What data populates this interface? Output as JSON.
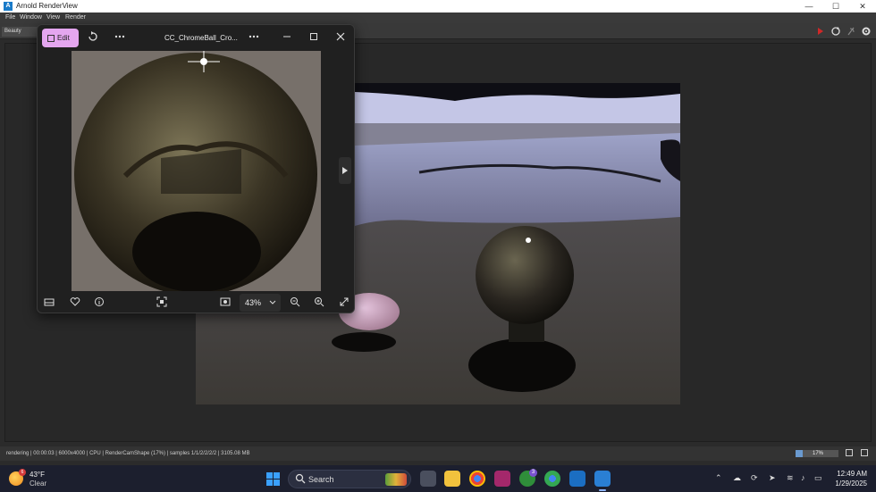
{
  "window": {
    "app_icon_glyph": "A",
    "title": "Arnold RenderView",
    "minimize": "—",
    "maximize": "☐",
    "close": "✕"
  },
  "menu": [
    "File",
    "Window",
    "View",
    "Render"
  ],
  "toolbar": {
    "aov": "Beauty",
    "icons": [
      "record-icon",
      "refresh-icon",
      "antenna-icon",
      "gear-icon"
    ]
  },
  "status": {
    "text": "rendering | 00:00:03 | 6000x4000 | CPU | RenderCamShape (17%) | samples 1/1/2/2/2/2 | 3105.08 MB",
    "progress_percent": 17,
    "progress_label": "17%"
  },
  "photos": {
    "edit_label": "Edit",
    "title": "CC_ChromeBall_Cro...",
    "zoom_label": "43%",
    "colors": {
      "edit_bg": "#e4a6ef"
    }
  },
  "taskbar": {
    "weather_badge": "6",
    "temperature": "43°F",
    "condition": "Clear",
    "search_label": "Search",
    "xbox_badge": "3",
    "time": "12:49 AM",
    "date": "1/29/2025"
  }
}
